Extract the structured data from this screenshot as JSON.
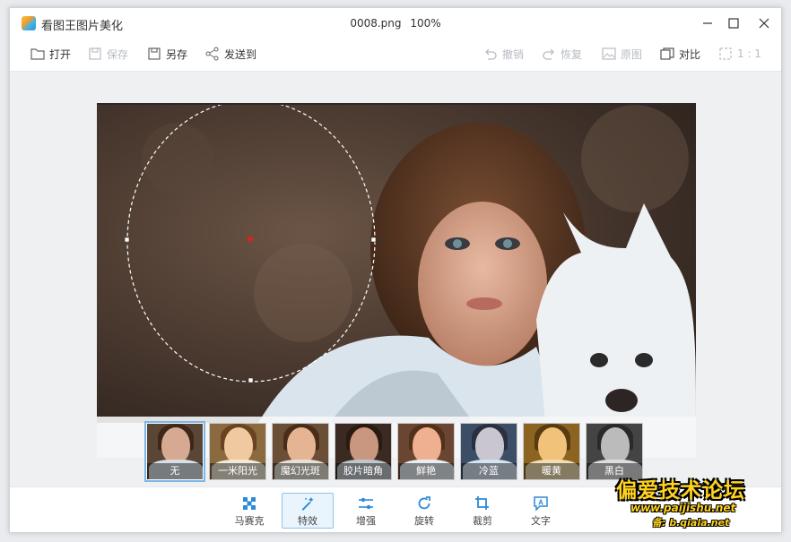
{
  "app": {
    "title": "看图王图片美化"
  },
  "file": {
    "name": "0008.png",
    "zoom": "100%"
  },
  "toolbar": {
    "open": "打开",
    "save": "保存",
    "save_as": "另存",
    "send_to": "发送到",
    "undo": "撤销",
    "redo": "恢复",
    "original": "原图",
    "compare": "对比",
    "actual_size": "1 : 1"
  },
  "filters": [
    {
      "label": "无",
      "active": true
    },
    {
      "label": "一米阳光",
      "active": false
    },
    {
      "label": "魔幻光斑",
      "active": false
    },
    {
      "label": "胶片暗角",
      "active": false
    },
    {
      "label": "鲜艳",
      "active": false
    },
    {
      "label": "冷蓝",
      "active": false
    },
    {
      "label": "暖黄",
      "active": false
    },
    {
      "label": "黑白",
      "active": false
    }
  ],
  "bottom_tools": [
    {
      "label": "马赛克",
      "icon": "mosaic-icon"
    },
    {
      "label": "特效",
      "icon": "magic-wand-icon",
      "active": true
    },
    {
      "label": "增强",
      "icon": "sliders-icon"
    },
    {
      "label": "旋转",
      "icon": "rotate-icon"
    },
    {
      "label": "裁剪",
      "icon": "crop-icon"
    },
    {
      "label": "文字",
      "icon": "text-icon"
    }
  ],
  "watermark": {
    "main": "偏爱技术论坛",
    "url": "www.paijishu.net",
    "backup": "备: b.qiala.net"
  }
}
